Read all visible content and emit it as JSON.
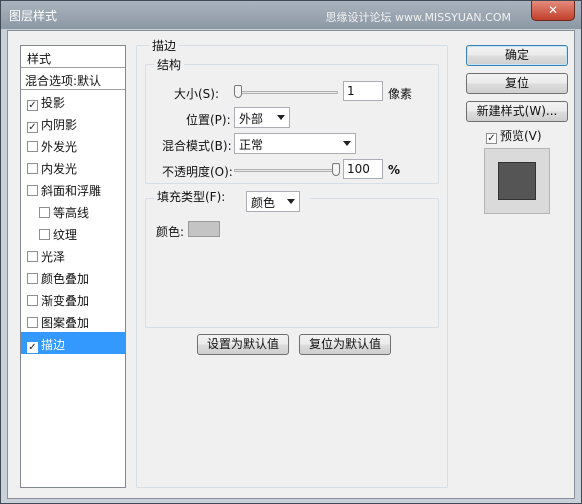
{
  "window": {
    "title": "图层样式",
    "watermark": "思缘设计论坛 www.MISSYUAN.COM",
    "close_glyph": "✕"
  },
  "style_list": {
    "header": "样式",
    "blend_options": "混合选项:默认",
    "items": [
      {
        "label": "投影",
        "checked": true
      },
      {
        "label": "内阴影",
        "checked": true
      },
      {
        "label": "外发光",
        "checked": false
      },
      {
        "label": "内发光",
        "checked": false
      },
      {
        "label": "斜面和浮雕",
        "checked": false
      },
      {
        "label": "等高线",
        "checked": false
      },
      {
        "label": "纹理",
        "checked": false
      },
      {
        "label": "光泽",
        "checked": false
      },
      {
        "label": "颜色叠加",
        "checked": false
      },
      {
        "label": "渐变叠加",
        "checked": false
      },
      {
        "label": "图案叠加",
        "checked": false
      },
      {
        "label": "描边",
        "checked": true
      }
    ]
  },
  "stroke": {
    "title": "描边",
    "structure_title": "结构",
    "size_label": "大小(S):",
    "size_value": "1",
    "size_unit": "像素",
    "size_slider_fraction": 0.0,
    "position_label": "位置(P):",
    "position_value": "外部",
    "blend_mode_label": "混合模式(B):",
    "blend_mode_value": "正常",
    "opacity_label": "不透明度(O):",
    "opacity_value": "100",
    "opacity_unit": "%",
    "opacity_slider_fraction": 1.0,
    "fill_type_label": "填充类型(F):",
    "fill_type_value": "颜色",
    "color_label": "颜色:",
    "color_swatch": "#c4c4c4"
  },
  "buttons": {
    "make_default": "设置为默认值",
    "reset_default": "复位为默认值",
    "ok": "确定",
    "reset": "复位",
    "new_style": "新建样式(W)...",
    "preview_label": "预览(V)",
    "preview_checked": true
  },
  "colors": {
    "selection": "#3399ff",
    "preview_fill": "#555555"
  }
}
